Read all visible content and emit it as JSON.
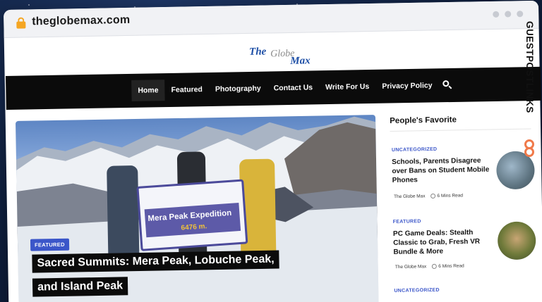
{
  "browser": {
    "url": "theglobemax.com"
  },
  "logo": {
    "word1": "The",
    "word2": "Globe",
    "word3": "Max"
  },
  "nav": {
    "items": [
      "Home",
      "Featured",
      "Photography",
      "Contact Us",
      "Write For Us",
      "Privacy Policy"
    ],
    "active": "Home"
  },
  "hero": {
    "badge": "FEATURED",
    "title_line1": "Sacred Summits: Mera Peak, Lobuche Peak,",
    "title_line2": "and Island Peak",
    "banner_title": "Mera Peak Expedition",
    "banner_height": "6476 m."
  },
  "sidebar": {
    "title": "People's Favorite",
    "articles": [
      {
        "category": "UNCATEGORIZED",
        "title": "Schools, Parents Disagree over Bans on Student Mobile Phones",
        "author": "The Globe Max",
        "read_time": "6 Mins Read"
      },
      {
        "category": "FEATURED",
        "title": "PC Game Deals: Stealth Classic to Grab, Fresh VR Bundle & More",
        "author": "The Globe Max",
        "read_time": "6 Mins Read"
      },
      {
        "category": "UNCATEGORIZED",
        "title": "",
        "author": "",
        "read_time": ""
      }
    ]
  },
  "watermark": {
    "text": "GUESTPOSTLINKS"
  },
  "colors": {
    "accent": "#3b56c9",
    "navbar": "#0b0b0b",
    "brand_orange": "#f07a4a"
  }
}
